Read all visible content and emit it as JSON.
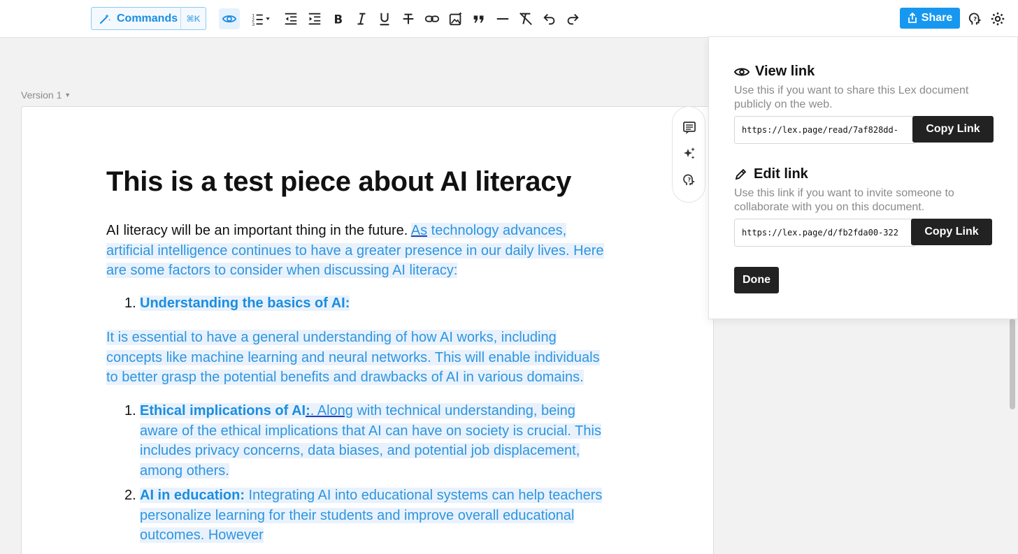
{
  "toolbar": {
    "commands_label": "Commands",
    "commands_shortcut": "⌘K",
    "share_label": "Share"
  },
  "version_label": "Version 1",
  "document": {
    "title": "This is a test piece about AI literacy",
    "intro_plain": "AI literacy will be an important thing in the future. ",
    "intro_link": "As",
    "intro_hl_1": " technology advances,",
    "intro_line_2": "artificial intelligence continues to have a greater presence in our daily lives. Here",
    "intro_line_3": "are some factors to consider when discussing AI literacy:",
    "item1_num": "1.",
    "item1_head": "Understanding the basics of AI:",
    "para2_line_1": " It is essential to have a general understanding of how AI works, including",
    "para2_line_2": "concepts like machine learning and neural networks. This will enable individuals",
    "para2_line_3": "to better grasp the potential benefits and drawbacks of AI in various domains.",
    "item2_num": "1.",
    "item2_head": "Ethical implications of AI",
    "item2_colon": ":",
    "item2_link": ". Along",
    "item2_l1_rest": " with technical understanding, being",
    "item2_line_2": "aware of the ethical implications that AI can have on society is crucial. This",
    "item2_line_3": "includes privacy concerns, data biases, and potential job displacement,",
    "item2_line_4": "among others.",
    "item3_num": "2.",
    "item3_head": "AI in education:",
    "item3_l1_rest": " Integrating AI into educational systems can help teachers",
    "item3_line_2": "personalize learning for their students and improve overall educational",
    "item3_line_3": "outcomes. However"
  },
  "share_panel": {
    "view_title": "View link",
    "view_desc": "Use this if you want to share this Lex document publicly on the web.",
    "view_url": "https://lex.page/read/7af828dd-",
    "edit_title": "Edit link",
    "edit_desc": "Use this link if you want to invite someone to collaborate with you on this document.",
    "edit_url": "https://lex.page/d/fb2fda00-322",
    "copy_label": "Copy Link",
    "done_label": "Done"
  },
  "colors": {
    "accent": "#1798f0",
    "highlight_bg": "#e9f2fc",
    "highlight_text": "#2e95e0",
    "dark_button": "#222222"
  }
}
